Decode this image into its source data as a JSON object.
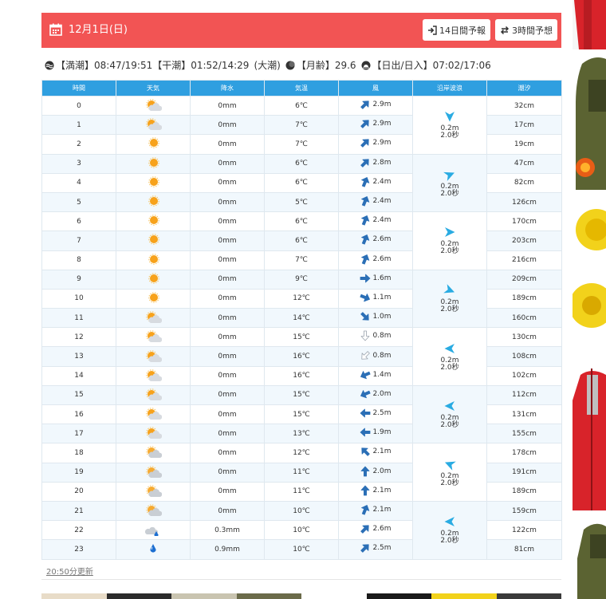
{
  "header": {
    "date": "12月1日(日)",
    "btn14": "14日間予報",
    "btn3": "3時間予想"
  },
  "info": {
    "high": "【満潮】08:47/19:51",
    "low": "【干潮】01:52/14:29",
    "tide_type": "(大潮)",
    "moon": "【月齢】29.6",
    "sun": "【日出/日入】07:02/17:06"
  },
  "table": {
    "headers": [
      "時間",
      "天気",
      "降水",
      "気温",
      "風",
      "沿岸波浪",
      "潮汐"
    ],
    "rows": [
      {
        "hour": "0",
        "weather": "partly-cloudy",
        "rain": "0mm",
        "temp": "6℃",
        "wind_dir": "ne",
        "wind": "2.9m",
        "tide": "32cm"
      },
      {
        "hour": "1",
        "weather": "partly-cloudy",
        "rain": "0mm",
        "temp": "7℃",
        "wind_dir": "ne",
        "wind": "2.9m",
        "tide": "17cm"
      },
      {
        "hour": "2",
        "weather": "sunny",
        "rain": "0mm",
        "temp": "7℃",
        "wind_dir": "ne",
        "wind": "2.9m",
        "tide": "19cm"
      },
      {
        "hour": "3",
        "weather": "sunny",
        "rain": "0mm",
        "temp": "6℃",
        "wind_dir": "ne",
        "wind": "2.8m",
        "tide": "47cm"
      },
      {
        "hour": "4",
        "weather": "sunny",
        "rain": "0mm",
        "temp": "6℃",
        "wind_dir": "nne",
        "wind": "2.4m",
        "tide": "82cm"
      },
      {
        "hour": "5",
        "weather": "sunny",
        "rain": "0mm",
        "temp": "5℃",
        "wind_dir": "nne",
        "wind": "2.4m",
        "tide": "126cm"
      },
      {
        "hour": "6",
        "weather": "sunny",
        "rain": "0mm",
        "temp": "6℃",
        "wind_dir": "nne",
        "wind": "2.4m",
        "tide": "170cm"
      },
      {
        "hour": "7",
        "weather": "sunny",
        "rain": "0mm",
        "temp": "6℃",
        "wind_dir": "nne",
        "wind": "2.6m",
        "tide": "203cm"
      },
      {
        "hour": "8",
        "weather": "sunny",
        "rain": "0mm",
        "temp": "7℃",
        "wind_dir": "nne",
        "wind": "2.6m",
        "tide": "216cm"
      },
      {
        "hour": "9",
        "weather": "sunny",
        "rain": "0mm",
        "temp": "9℃",
        "wind_dir": "e",
        "wind": "1.6m",
        "tide": "209cm"
      },
      {
        "hour": "10",
        "weather": "sunny",
        "rain": "0mm",
        "temp": "12℃",
        "wind_dir": "ese",
        "wind": "1.1m",
        "tide": "189cm"
      },
      {
        "hour": "11",
        "weather": "partly-cloudy",
        "rain": "0mm",
        "temp": "14℃",
        "wind_dir": "se",
        "wind": "1.0m",
        "tide": "160cm"
      },
      {
        "hour": "12",
        "weather": "partly-cloudy",
        "rain": "0mm",
        "temp": "15℃",
        "wind_dir": "s-light",
        "wind": "0.8m",
        "tide": "130cm"
      },
      {
        "hour": "13",
        "weather": "partly-cloudy",
        "rain": "0mm",
        "temp": "16℃",
        "wind_dir": "sw-light",
        "wind": "0.8m",
        "tide": "108cm"
      },
      {
        "hour": "14",
        "weather": "partly-cloudy",
        "rain": "0mm",
        "temp": "16℃",
        "wind_dir": "wsw",
        "wind": "1.4m",
        "tide": "102cm"
      },
      {
        "hour": "15",
        "weather": "partly-cloudy",
        "rain": "0mm",
        "temp": "15℃",
        "wind_dir": "wsw",
        "wind": "2.0m",
        "tide": "112cm"
      },
      {
        "hour": "16",
        "weather": "partly-cloudy",
        "rain": "0mm",
        "temp": "15℃",
        "wind_dir": "w",
        "wind": "2.5m",
        "tide": "131cm"
      },
      {
        "hour": "17",
        "weather": "partly-cloudy",
        "rain": "0mm",
        "temp": "13℃",
        "wind_dir": "w",
        "wind": "1.9m",
        "tide": "155cm"
      },
      {
        "hour": "18",
        "weather": "mostly-cloudy",
        "rain": "0mm",
        "temp": "12℃",
        "wind_dir": "nw",
        "wind": "2.1m",
        "tide": "178cm"
      },
      {
        "hour": "19",
        "weather": "mostly-cloudy",
        "rain": "0mm",
        "temp": "11℃",
        "wind_dir": "n",
        "wind": "2.0m",
        "tide": "191cm"
      },
      {
        "hour": "20",
        "weather": "mostly-cloudy",
        "rain": "0mm",
        "temp": "11℃",
        "wind_dir": "n",
        "wind": "2.1m",
        "tide": "189cm"
      },
      {
        "hour": "21",
        "weather": "mostly-cloudy",
        "rain": "0mm",
        "temp": "10℃",
        "wind_dir": "nne",
        "wind": "2.1m",
        "tide": "159cm"
      },
      {
        "hour": "22",
        "weather": "cloud-rain",
        "rain": "0.3mm",
        "temp": "10℃",
        "wind_dir": "ne",
        "wind": "2.6m",
        "tide": "122cm"
      },
      {
        "hour": "23",
        "weather": "rain",
        "rain": "0.9mm",
        "temp": "10℃",
        "wind_dir": "ne",
        "wind": "2.5m",
        "tide": "81cm"
      }
    ],
    "coastal": [
      {
        "dir": "s",
        "height": "0.2m",
        "period": "2.0秒"
      },
      {
        "dir": "ene",
        "height": "0.2m",
        "period": "2.0秒"
      },
      {
        "dir": "e",
        "height": "0.2m",
        "period": "2.0秒"
      },
      {
        "dir": "ese",
        "height": "0.2m",
        "period": "2.0秒"
      },
      {
        "dir": "w",
        "height": "0.2m",
        "period": "2.0秒"
      },
      {
        "dir": "w",
        "height": "0.2m",
        "period": "2.0秒"
      },
      {
        "dir": "wnw",
        "height": "0.2m",
        "period": "2.0秒"
      },
      {
        "dir": "w",
        "height": "0.2m",
        "period": "2.0秒"
      }
    ]
  },
  "updated": "20:50分更新",
  "colors": {
    "header": "#f25454",
    "table_header": "#2f9fe0",
    "wind_arrow": "#2b6fb6",
    "wave_arrow": "#29abe2"
  }
}
